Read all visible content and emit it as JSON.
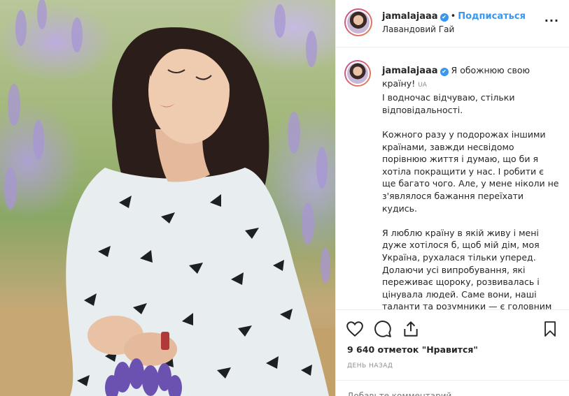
{
  "post": {
    "username": "jamalajaaa",
    "verified": true,
    "follow_label": "Подписаться",
    "separator": "•",
    "location": "Лавандовий Гай",
    "more_icon": "more-horizontal-icon"
  },
  "caption": {
    "username": "jamalajaaa",
    "first_line": "Я обожнюю свою країну!",
    "lang_tag": "UA",
    "paragraphs": [
      "І водночас відчуваю, стільки відповідальності.",
      "Кожного разу у подорожах іншими країнами, завжди несвідомо порівнюю життя і думаю, що би я хотіла покращити у нас. І робити є ще багато чого. Але, у мене ніколи не з'являлося бажання переїхати кудись.",
      "Я люблю країну в якій живу і мені дуже хотілося б, щоб мій дім, моя Україна, рухалася тільки уперед. Долаючи усі випробування, які переживає щороку, розвивалась і цінувала людей. Саме вони, наші таланти та розумники — є головним"
    ]
  },
  "actions": {
    "like_icon": "heart-icon",
    "comment_icon": "comment-icon",
    "share_icon": "share-icon",
    "save_icon": "bookmark-icon",
    "likes_text": "9 640 отметок \"Нравится\"",
    "timestamp": "ДЕНЬ НАЗАД",
    "comment_placeholder": "Добавьте комментарий..."
  },
  "colors": {
    "accent": "#3897f0",
    "text": "#262626",
    "muted": "#8e8e8e"
  }
}
